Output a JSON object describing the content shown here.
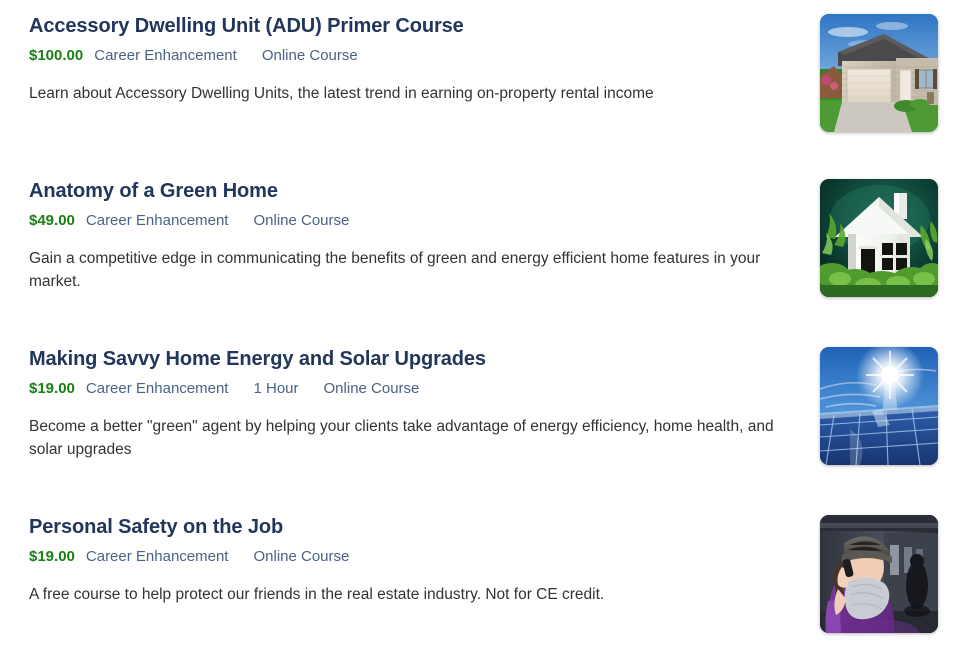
{
  "page": {
    "background": "#ffffff",
    "title_color": "#22365c",
    "price_color": "#1a8016",
    "meta_color": "#4a6285",
    "desc_color": "#333333"
  },
  "courses": [
    {
      "title": "Accessory Dwelling Unit (ADU) Primer Course",
      "price": "$100.00",
      "tags": [
        "Career Enhancement",
        "Online Course"
      ],
      "description": "Learn about Accessory Dwelling Units, the latest trend in earning on-property rental income",
      "thumbnail": "suburban-garage-house-photo"
    },
    {
      "title": "Anatomy of a Green Home",
      "price": "$49.00",
      "tags": [
        "Career Enhancement",
        "Online Course"
      ],
      "description": "Gain a competitive edge in communicating the benefits of green and energy efficient home features in your market.",
      "thumbnail": "white-house-model-greenery-photo"
    },
    {
      "title": "Making Savvy Home Energy and Solar Upgrades",
      "price": "$19.00",
      "tags": [
        "Career Enhancement",
        "1 Hour",
        "Online Course"
      ],
      "description": "Become a better \"green\" agent by helping your clients take advantage of energy efficiency, home health, and solar upgrades",
      "thumbnail": "solar-panels-sun-photo"
    },
    {
      "title": "Personal Safety on the Job",
      "price": "$19.00",
      "tags": [
        "Career Enhancement",
        "Online Course"
      ],
      "description": "A free course to help protect our friends in the real estate industry. Not for CE credit.",
      "thumbnail": "woman-on-phone-corridor-photo"
    }
  ]
}
